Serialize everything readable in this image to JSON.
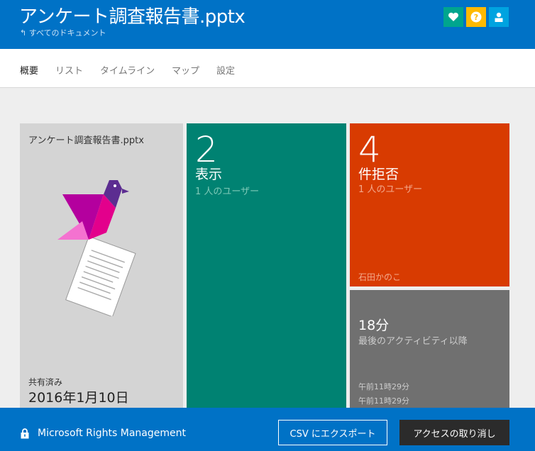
{
  "header": {
    "title": "アンケート調査報告書.pptx",
    "back_link": "すべてのドキュメント",
    "icons": [
      "heart-icon",
      "help-icon",
      "user-icon"
    ]
  },
  "nav": {
    "tabs": [
      {
        "label": "概要",
        "active": true
      },
      {
        "label": "リスト",
        "active": false
      },
      {
        "label": "タイムライン",
        "active": false
      },
      {
        "label": "マップ",
        "active": false
      },
      {
        "label": "設定",
        "active": false
      }
    ]
  },
  "doc_tile": {
    "filename": "アンケート調査報告書.pptx",
    "shared_label": "共有済み",
    "shared_date": "2016年1月10日"
  },
  "views_tile": {
    "count": "2",
    "label": "表示",
    "sub": "1 人のユーザー"
  },
  "denied_tile": {
    "count": "4",
    "label": "件拒否",
    "sub": "1 人のユーザー",
    "user": "石田かのこ"
  },
  "time_tile": {
    "value": "18分",
    "label": "最後のアクティビティ以降",
    "times": [
      "午前11時29分",
      "午前11時29分"
    ]
  },
  "footer": {
    "brand": "Microsoft Rights Management",
    "export_label": "CSV にエクスポート",
    "revoke_label": "アクセスの取り消し"
  },
  "colors": {
    "brand_blue": "#0072c6",
    "views_teal": "#008272",
    "denied_orange": "#d83b01",
    "time_gray": "#707070",
    "doc_gray": "#d4d4d4"
  }
}
